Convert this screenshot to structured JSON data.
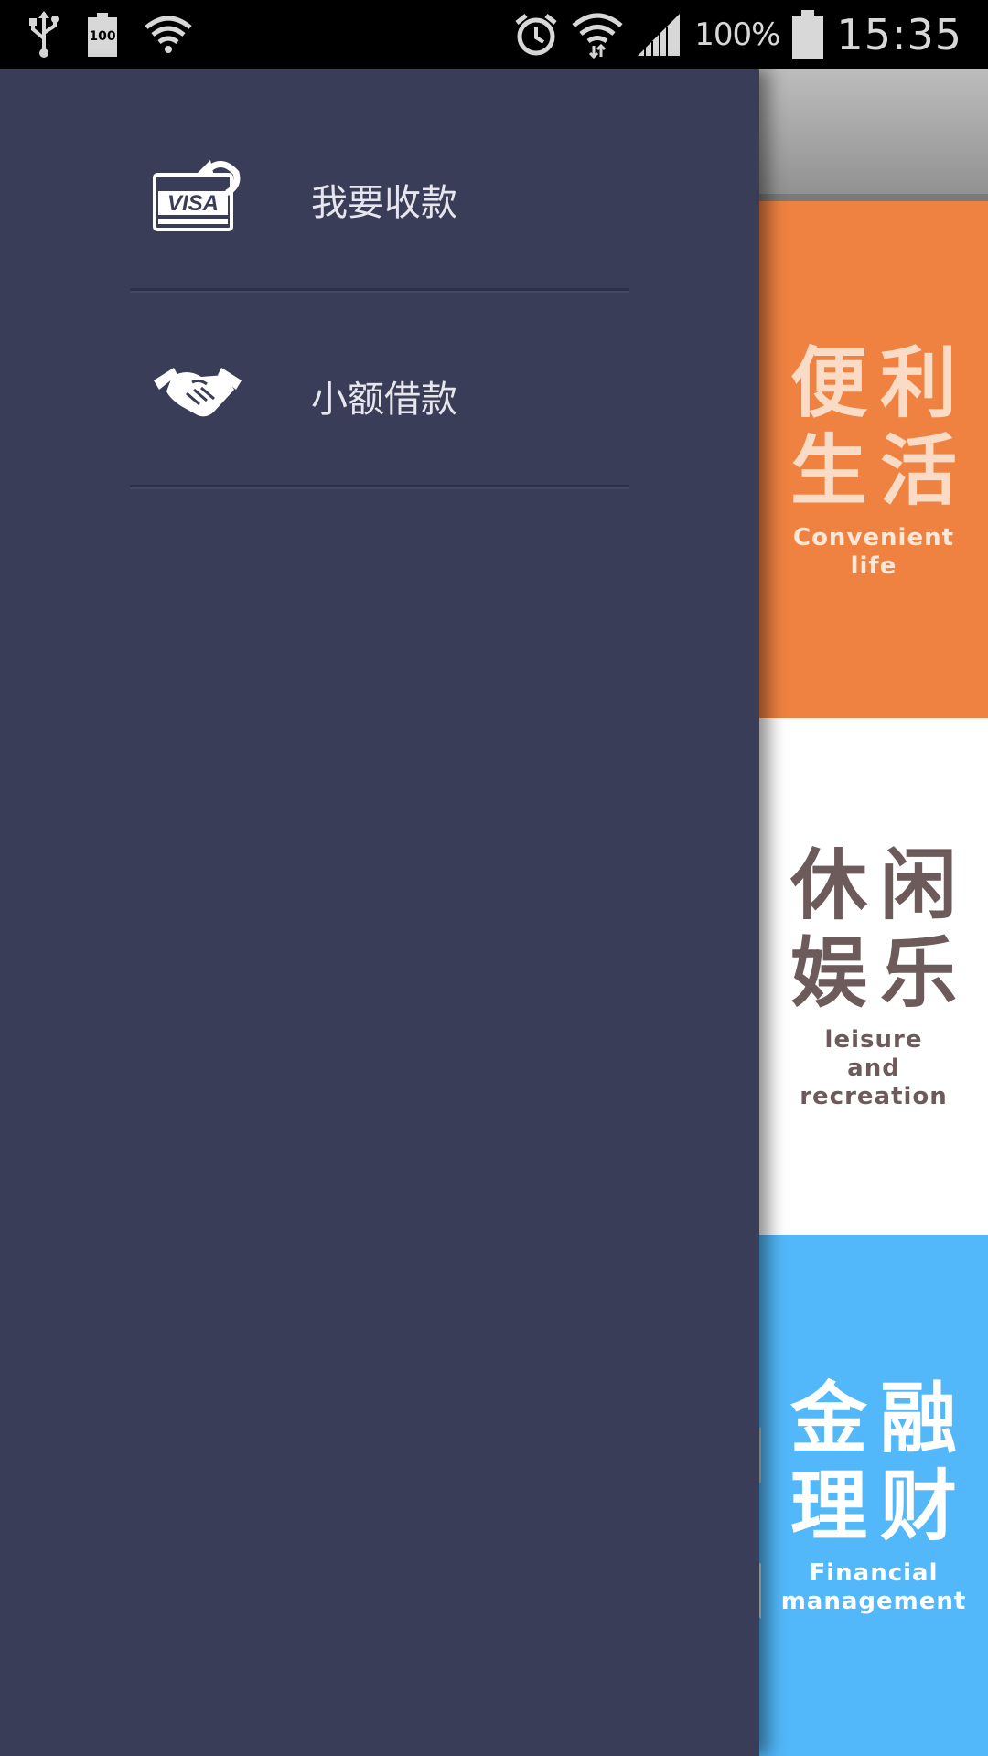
{
  "status_bar": {
    "battery_small_label": "100",
    "battery_percent": "100%",
    "time": "15:35",
    "icons": [
      "usb-icon",
      "battery-status-icon",
      "wifi-question-icon",
      "alarm-icon",
      "wifi-icon",
      "signal-icon",
      "battery-icon"
    ]
  },
  "drawer": {
    "items": [
      {
        "label": "我要收款",
        "icon": "visa-card-icon",
        "icon_text": "VISA"
      },
      {
        "label": "小额借款",
        "icon": "handshake-icon"
      }
    ]
  },
  "content": {
    "tiles": [
      {
        "zh_line1": "便利",
        "zh_line2": "生活",
        "en_line1": "Convenient",
        "en_line2": "life",
        "color": "#ef8240"
      },
      {
        "zh_line1": "休闲",
        "zh_line2": "娱乐",
        "en_line1": "leisure",
        "en_line2": "and",
        "en_line3": "recreation",
        "color": "#ffffff"
      },
      {
        "zh_line1": "金融",
        "zh_line2": "理财",
        "en_line1": "Financial",
        "en_line2": "management",
        "color": "#52b8f9"
      }
    ]
  },
  "colors": {
    "drawer_bg": "#3a3d57",
    "status_bar_bg": "#000000"
  }
}
